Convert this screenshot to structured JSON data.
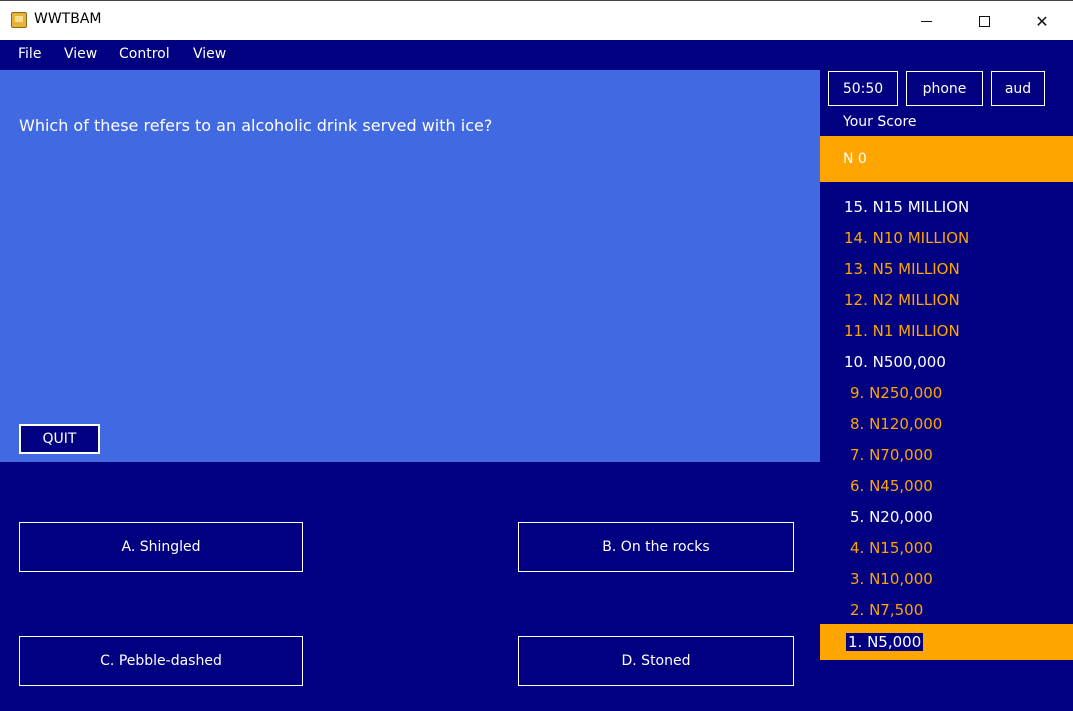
{
  "window": {
    "title": "WWTBAM",
    "app_icon": "wwtbam-app-icon",
    "controls": {
      "minimize": "minimize-icon",
      "maximize": "maximize-icon",
      "close": "close-icon"
    }
  },
  "menu": {
    "items": [
      {
        "label": "File"
      },
      {
        "label": "View"
      },
      {
        "label": "Control"
      },
      {
        "label": "View"
      }
    ]
  },
  "question": {
    "text": "Which of these refers to an alcoholic drink served with ice?",
    "quit_label": "QUIT"
  },
  "answers": {
    "a": "A. Shingled",
    "b": "B. On the rocks",
    "c": "C. Pebble-dashed",
    "d": "D. Stoned"
  },
  "lifelines": {
    "fifty_fifty": "50:50",
    "phone": "phone",
    "audience": "aud"
  },
  "score": {
    "label": "Your Score",
    "value": "N  0"
  },
  "ladder": [
    {
      "label": "15.  N15 MILLION",
      "tone": "white"
    },
    {
      "label": "14.  N10 MILLION",
      "tone": "orange"
    },
    {
      "label": "13.  N5 MILLION",
      "tone": "orange"
    },
    {
      "label": "12.  N2 MILLION",
      "tone": "orange"
    },
    {
      "label": "11.  N1 MILLION",
      "tone": "orange"
    },
    {
      "label": "10.  N500,000",
      "tone": "white"
    },
    {
      "label": "9.  N250,000",
      "tone": "orange"
    },
    {
      "label": "8.  N120,000",
      "tone": "orange"
    },
    {
      "label": "7.  N70,000",
      "tone": "orange"
    },
    {
      "label": "6.  N45,000",
      "tone": "orange"
    },
    {
      "label": "5.  N20,000",
      "tone": "white"
    },
    {
      "label": "4.  N15,000",
      "tone": "orange"
    },
    {
      "label": "3.  N10,000",
      "tone": "orange"
    },
    {
      "label": "2.  N7,500",
      "tone": "orange"
    },
    {
      "label": "1.  N5,000",
      "tone": "current"
    }
  ],
  "colors": {
    "background": "#000080",
    "question_panel": "#4169E1",
    "highlight": "#FFA500",
    "text": "#FFFFFF"
  }
}
